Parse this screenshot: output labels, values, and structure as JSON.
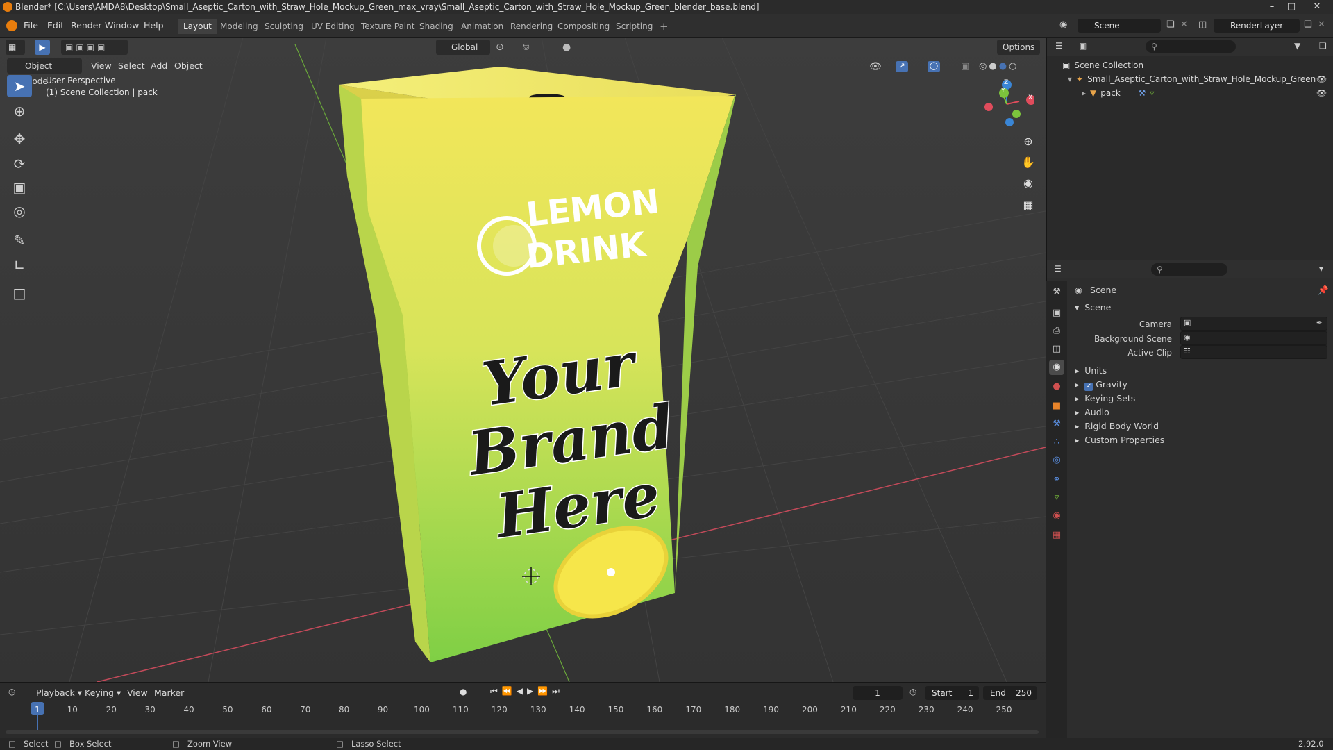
{
  "window": {
    "title": "Blender* [C:\\Users\\AMDA8\\Desktop\\Small_Aseptic_Carton_with_Straw_Hole_Mockup_Green_max_vray\\Small_Aseptic_Carton_with_Straw_Hole_Mockup_Green_blender_base.blend]",
    "minimize": "–",
    "maximize": "□",
    "close": "✕"
  },
  "menus": [
    "File",
    "Edit",
    "Render",
    "Window",
    "Help"
  ],
  "workspaces": [
    "Layout",
    "Modeling",
    "Sculpting",
    "UV Editing",
    "Texture Paint",
    "Shading",
    "Animation",
    "Rendering",
    "Compositing",
    "Scripting"
  ],
  "workspace_add": "+",
  "scene_field": "Scene",
  "renderlayer_field": "RenderLayer",
  "viewport": {
    "orientation": "Global",
    "options_label": "Options",
    "mode": "Object Mode",
    "menu": [
      "View",
      "Select",
      "Add",
      "Object"
    ],
    "info_line1": "User Perspective",
    "info_line2": "(1) Scene Collection | pack",
    "axis_x": "X",
    "axis_y": "Y",
    "axis_z": "Z",
    "carton_text": {
      "brand1": "LEMON",
      "brand2": "DRINK",
      "script1": "Your",
      "script2": "Brand",
      "script3": "Here"
    }
  },
  "outliner": {
    "root": "Scene Collection",
    "items": [
      {
        "label": "Small_Aseptic_Carton_with_Straw_Hole_Mockup_Green"
      },
      {
        "label": "pack"
      }
    ]
  },
  "properties": {
    "header": "Scene",
    "panel": "Scene",
    "fields": [
      {
        "label": "Camera"
      },
      {
        "label": "Background Scene"
      },
      {
        "label": "Active Clip"
      }
    ],
    "sections": [
      "Units",
      "Gravity",
      "Keying Sets",
      "Audio",
      "Rigid Body World",
      "Custom Properties"
    ],
    "gravity_checked": true
  },
  "timeline": {
    "menus": [
      "Playback",
      "Keying",
      "View",
      "Marker"
    ],
    "current_frame": "1",
    "start_label": "Start",
    "start_value": "1",
    "end_label": "End",
    "end_value": "250",
    "ruler": [
      "1",
      "10",
      "20",
      "30",
      "40",
      "50",
      "60",
      "70",
      "80",
      "90",
      "100",
      "110",
      "120",
      "130",
      "140",
      "150",
      "160",
      "170",
      "180",
      "190",
      "200",
      "210",
      "220",
      "230",
      "240",
      "250"
    ]
  },
  "statusbar": {
    "select": "Select",
    "box_select": "Box Select",
    "zoom_view": "Zoom View",
    "lasso_select": "Lasso Select",
    "version": "2.92.0"
  },
  "colors": {
    "accent": "#4772b3",
    "axis_x": "#e04c5c",
    "axis_y": "#7cc43c",
    "axis_z": "#3a86d6"
  }
}
